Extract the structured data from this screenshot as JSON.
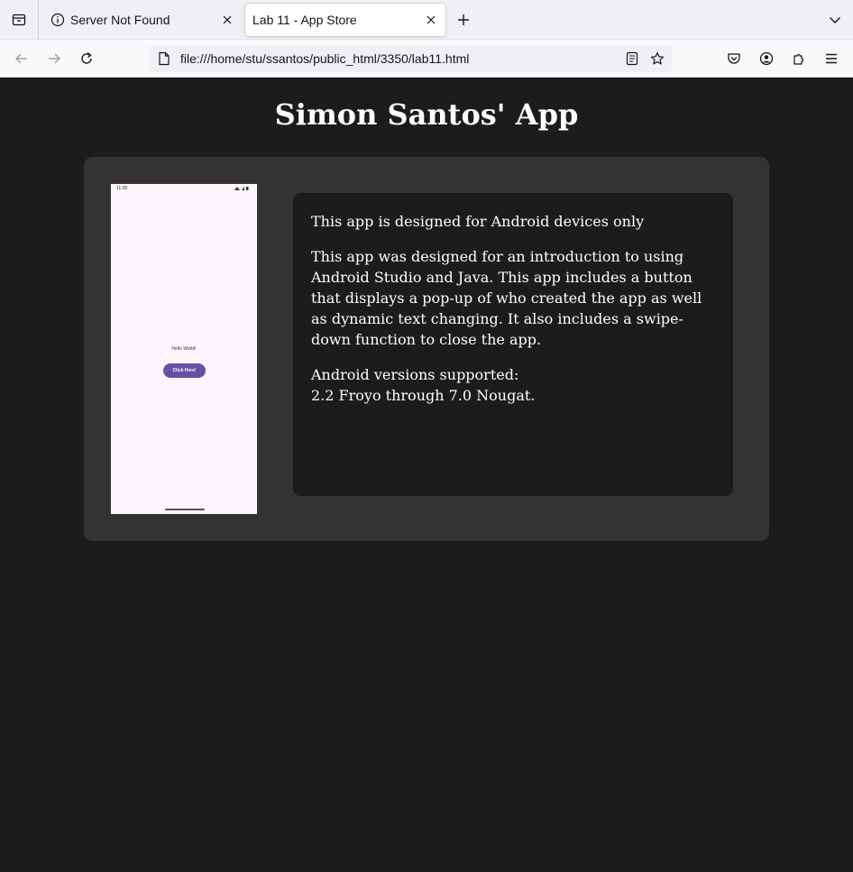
{
  "browser": {
    "tabs": [
      {
        "label": "Server Not Found",
        "icon": "info-icon",
        "active": false
      },
      {
        "label": "Lab 11 - App Store",
        "icon": "",
        "active": true
      }
    ],
    "url": "file:///home/stu/ssantos/public_html/3350/lab11.html"
  },
  "page": {
    "title": "Simon Santos' App",
    "app_screenshot": {
      "status_time": "11:28",
      "hello_text": "Hello World!",
      "button_label": "Click Here!"
    },
    "description": {
      "line1": "This app is designed for Android devices only",
      "line2": "This app was designed for an introduction to using Android Studio and Java. This app includes a button that displays a pop-up of who created the app as well as dynamic text changing. It also includes a swipe-down function to close the app.",
      "versions_label": "Android versions supported:",
      "versions_value": "2.2 Froyo through 7.0 Nougat."
    }
  },
  "colors": {
    "page_bg": "#1c1c1c",
    "card_bg": "#333333",
    "button_purple": "#6750a4"
  }
}
